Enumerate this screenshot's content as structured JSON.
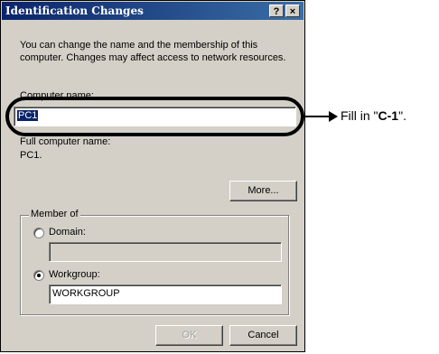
{
  "dialog": {
    "title": "Identification Changes",
    "help_glyph": "?",
    "close_glyph": "×",
    "intro": "You can change the name and the membership of this computer. Changes may affect access to network resources.",
    "computer_name_label": "Computer name:",
    "computer_name_value": "PC1",
    "full_name_label": "Full computer name:",
    "full_name_value": "PC1.",
    "more_button": "More...",
    "member_of": {
      "title": "Member of",
      "domain_label": "Domain:",
      "domain_value": "",
      "domain_selected": false,
      "workgroup_label": "Workgroup:",
      "workgroup_value": "WORKGROUP",
      "workgroup_selected": true
    },
    "ok_button": "OK",
    "cancel_button": "Cancel"
  },
  "annotation": {
    "prefix": "Fill in \"",
    "value": "C-1",
    "suffix": "\"."
  },
  "colors": {
    "dialog_bg": "#d4d0c8",
    "titlebar_start": "#0a246a",
    "titlebar_end": "#3a6ea5",
    "selection": "#0a246a"
  }
}
